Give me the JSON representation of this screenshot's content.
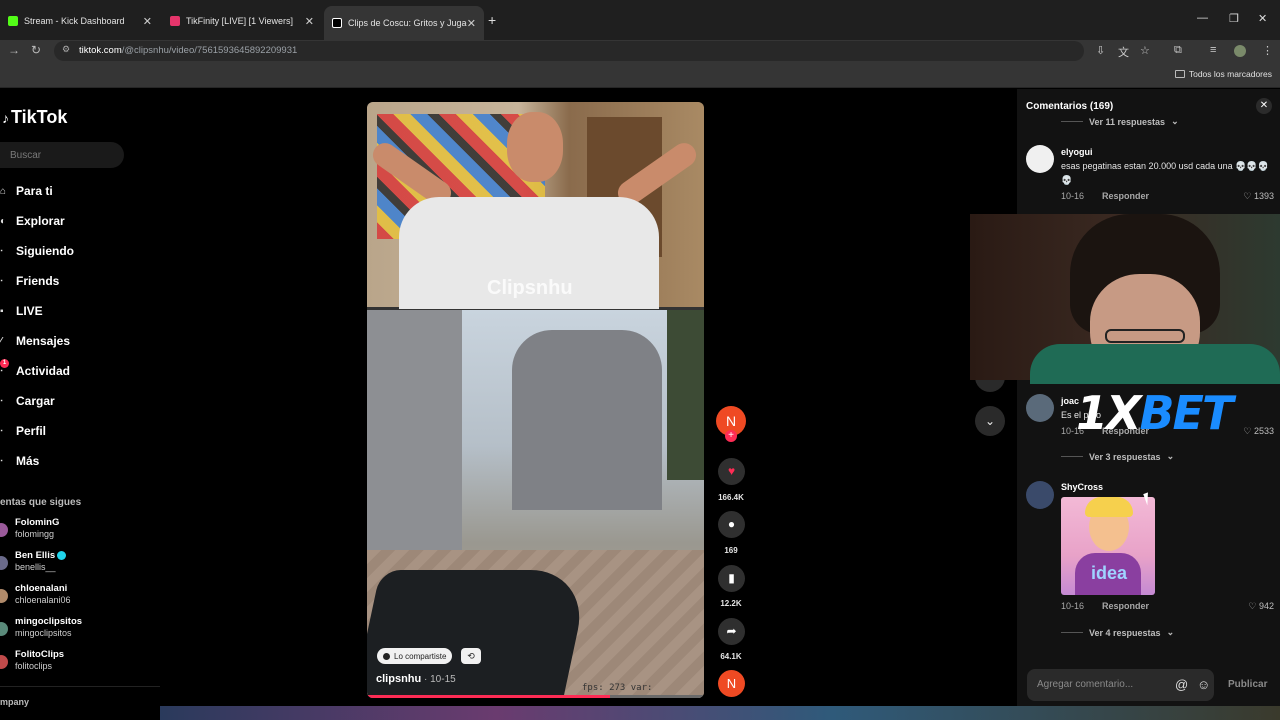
{
  "browser": {
    "tabs": [
      {
        "label": "Stream - Kick Dashboard",
        "favicon_color": "#53fc18"
      },
      {
        "label": "TikFinity [LIVE] [1 Viewers]",
        "favicon_color": "#e5356b"
      },
      {
        "label": "Clips de Coscu: Gritos y Jugad",
        "favicon_color": "#ffffff"
      }
    ],
    "tab_close_glyph": "✕",
    "new_tab_glyph": "+",
    "url_domain": "tiktok.com",
    "url_path": "/@clipsnhu/video/7561593645892209931",
    "bookmarks_label": "Todos los marcadores"
  },
  "sidebar": {
    "logo": "TikTok",
    "search_placeholder": "Buscar",
    "nav": [
      {
        "label": "Para ti",
        "icon": "home-icon"
      },
      {
        "label": "Explorar",
        "icon": "compass-icon"
      },
      {
        "label": "Siguiendo",
        "icon": "following-icon"
      },
      {
        "label": "Friends",
        "icon": "friends-icon"
      },
      {
        "label": "LIVE",
        "icon": "live-icon"
      },
      {
        "label": "Mensajes",
        "icon": "messages-icon"
      },
      {
        "label": "Actividad",
        "icon": "activity-icon",
        "badge": "1"
      },
      {
        "label": "Cargar",
        "icon": "upload-icon"
      },
      {
        "label": "Perfil",
        "icon": "profile-icon"
      },
      {
        "label": "Más",
        "icon": "more-icon"
      }
    ],
    "following_heading": "entas que sigues",
    "accounts": [
      {
        "name": "FolominG",
        "handle": "folomingg",
        "verified": false
      },
      {
        "name": "Ben Ellis",
        "handle": "benellis__",
        "verified": true
      },
      {
        "name": "chloenalani",
        "handle": "chloenalani06",
        "verified": false
      },
      {
        "name": "mingoclipsitos",
        "handle": "mingoclipsitos",
        "verified": false
      },
      {
        "name": "FolitoClips",
        "handle": "folitoclips",
        "verified": false
      }
    ],
    "footer": "mpany"
  },
  "video": {
    "watermark": "Clipsnhu",
    "author": "clipsnhu",
    "date": " · 10-15",
    "shared_label": "Lo compartiste",
    "fps_overlay": "fps:  273  var:",
    "progress": 0.72
  },
  "actions": {
    "avatar_letter": "N",
    "likes": "166.4K",
    "comments": "169",
    "saves": "12.2K",
    "shares": "64.1K"
  },
  "comments": {
    "title": "Comentarios (169)",
    "items": [
      {
        "replies": "Ver 11 respuestas"
      },
      {
        "user": "elyogui",
        "text": "esas pegatinas estan 20.000 usd cada una 💀💀💀💀",
        "date": "10-16",
        "reply": "Responder",
        "likes": "1393"
      },
      {
        "user": "joac",
        "text": "Es el puto",
        "date": "10-16",
        "reply": "Responder",
        "likes": "2533"
      },
      {
        "replies": "Ver 3 respuestas"
      },
      {
        "user": "ShyCross",
        "sticker": "idea",
        "date": "10-16",
        "reply": "Responder",
        "likes": "942"
      },
      {
        "replies": "Ver 4 respuestas"
      }
    ],
    "input_placeholder": "Agregar comentario...",
    "publish_label": "Publicar"
  },
  "overlay": {
    "sponsor_white": "1X",
    "sponsor_blue": "BET"
  },
  "colors": {
    "accent": "#fe2c55",
    "avatar": "#ef4a23",
    "sponsor_blue": "#1a8cff"
  }
}
